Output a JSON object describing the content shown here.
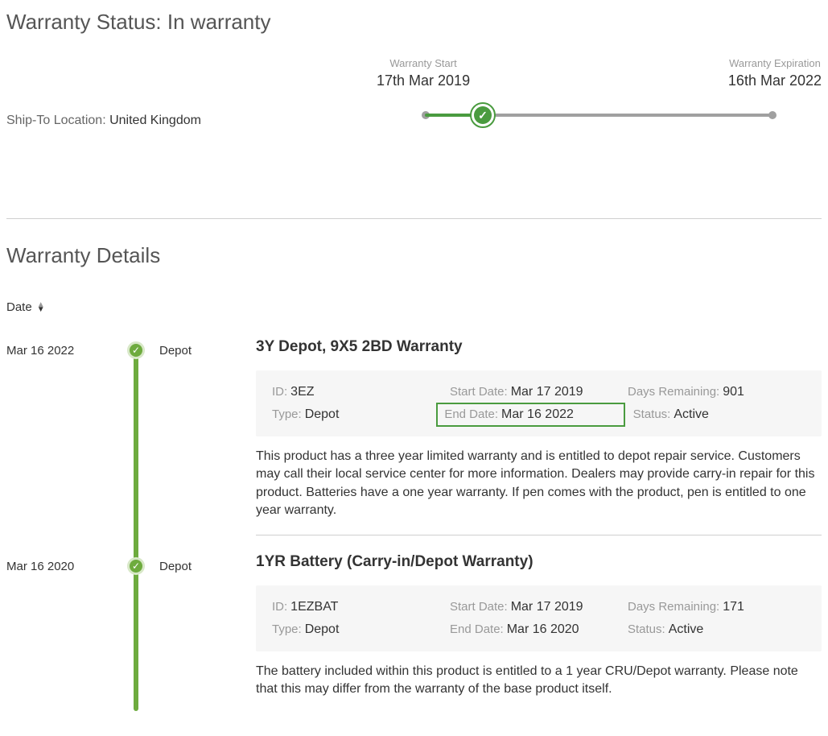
{
  "header": {
    "status_label": "Warranty Status:",
    "status_value": "In warranty",
    "ship_to_label": "Ship-To Location:",
    "ship_to_value": "United Kingdom",
    "warranty_start_label": "Warranty Start",
    "warranty_start_date": "17th Mar 2019",
    "warranty_end_label": "Warranty Expiration",
    "warranty_end_date": "16th Mar 2022"
  },
  "details": {
    "title": "Warranty Details",
    "sort_label": "Date",
    "timeline": [
      {
        "date": "Mar 16 2022",
        "type": "Depot"
      },
      {
        "date": "Mar 16 2020",
        "type": "Depot"
      }
    ],
    "labels": {
      "id": "ID:",
      "type": "Type:",
      "start": "Start Date:",
      "end": "End Date:",
      "days": "Days Remaining:",
      "status": "Status:"
    },
    "items": [
      {
        "title": "3Y Depot, 9X5 2BD Warranty",
        "id": "3EZ",
        "type": "Depot",
        "start": "Mar 17 2019",
        "end": "Mar 16 2022",
        "days": "901",
        "status": "Active",
        "highlight_end": true,
        "desc": "This product has a three year limited warranty and is entitled to depot repair service. Customers may call their local service center for more information. Dealers may provide carry-in repair for this product. Batteries have a one year warranty. If pen comes with the product, pen is entitled to one year warranty."
      },
      {
        "title": "1YR Battery (Carry-in/Depot Warranty)",
        "id": "1EZBAT",
        "type": "Depot",
        "start": "Mar 17 2019",
        "end": "Mar 16 2020",
        "days": "171",
        "status": "Active",
        "highlight_end": false,
        "desc": "The battery included within this product is entitled to a 1 year CRU/Depot warranty. Please note that this may differ from the warranty of the base product itself."
      }
    ]
  }
}
